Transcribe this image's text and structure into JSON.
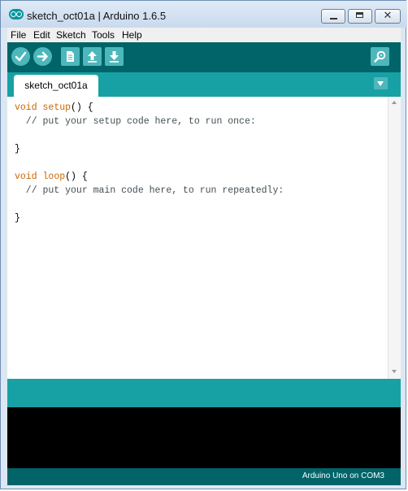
{
  "window": {
    "title": "sketch_oct01a | Arduino 1.6.5"
  },
  "menu": [
    {
      "label": "File"
    },
    {
      "label": "Edit"
    },
    {
      "label": "Sketch"
    },
    {
      "label": "Tools"
    },
    {
      "label": "Help"
    }
  ],
  "toolbar": {
    "buttons": [
      {
        "name": "verify",
        "icon": "check-icon"
      },
      {
        "name": "upload",
        "icon": "arrow-right-icon"
      },
      {
        "name": "new",
        "icon": "document-icon"
      },
      {
        "name": "open",
        "icon": "arrow-up-icon"
      },
      {
        "name": "save",
        "icon": "arrow-down-icon"
      },
      {
        "name": "serial-monitor",
        "icon": "magnifier-icon"
      }
    ]
  },
  "tabs": [
    {
      "label": "sketch_oct01a"
    }
  ],
  "code": {
    "setup_kw": "void",
    "setup_fn": "setup",
    "setup_rest": "() {",
    "setup_comment": "  // put your setup code here, to run once:",
    "setup_close": "}",
    "loop_kw": "void",
    "loop_fn": "loop",
    "loop_rest": "() {",
    "loop_comment": "  // put your main code here, to run repeatedly:",
    "loop_close": "}"
  },
  "status": {
    "board": "Arduino Uno on COM3"
  },
  "colors": {
    "toolbar": "#006468",
    "tabbar": "#17a1a5",
    "button": "#4db7bb",
    "keyword": "#cc6600",
    "console": "#000000"
  }
}
